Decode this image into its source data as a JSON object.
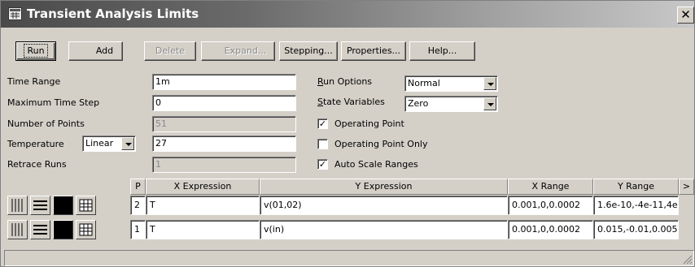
{
  "window": {
    "title": "Transient Analysis Limits",
    "close_glyph": "✕"
  },
  "toolbar": {
    "buttons": [
      {
        "label": "Run",
        "enabled": true,
        "default": true
      },
      {
        "label": "Add",
        "enabled": true
      },
      {
        "label": "Delete",
        "enabled": false
      },
      {
        "label": "Expand...",
        "enabled": false
      },
      {
        "label": "Stepping...",
        "enabled": true
      },
      {
        "label": "Properties...",
        "enabled": true
      },
      {
        "label": "Help...",
        "enabled": true
      }
    ]
  },
  "form": {
    "time_range": {
      "label": "Time Range",
      "value": "1m"
    },
    "max_time_step": {
      "label": "Maximum Time Step",
      "value": "0"
    },
    "num_points": {
      "label": "Number of Points",
      "value": "51"
    },
    "temperature": {
      "label": "Temperature",
      "mode": "Linear",
      "value": "27"
    },
    "retrace_runs": {
      "label": "Retrace Runs",
      "value": "1"
    }
  },
  "options": {
    "run_options": {
      "label": "Run Options",
      "value": "Normal"
    },
    "state_variables": {
      "label": "State Variables",
      "value": "Zero"
    },
    "operating_point": {
      "label": "Operating Point",
      "checked": true
    },
    "operating_point_only": {
      "label": "Operating Point Only",
      "checked": false
    },
    "auto_scale_ranges": {
      "label": "Auto Scale Ranges",
      "checked": true
    },
    "check_glyph": "✓"
  },
  "grid": {
    "headers": {
      "p": "P",
      "x_expr": "X Expression",
      "y_expr": "Y Expression",
      "x_range": "X Range",
      "y_range": "Y Range",
      "more": ">"
    },
    "rows": [
      {
        "p": "2",
        "x_expr": "T",
        "y_expr": "v(01,02)",
        "x_range": "0.001,0,0.0002",
        "y_range": "1.6e-10,-4e-11,4e",
        "color": "#000000"
      },
      {
        "p": "1",
        "x_expr": "T",
        "y_expr": "v(in)",
        "x_range": "0.001,0,0.0002",
        "y_range": "0.015,-0.01,0.005",
        "color": "#000000"
      }
    ]
  },
  "icons": {
    "title_icon": "window-app-icon",
    "resize_grip": "resize-grip-icon"
  }
}
